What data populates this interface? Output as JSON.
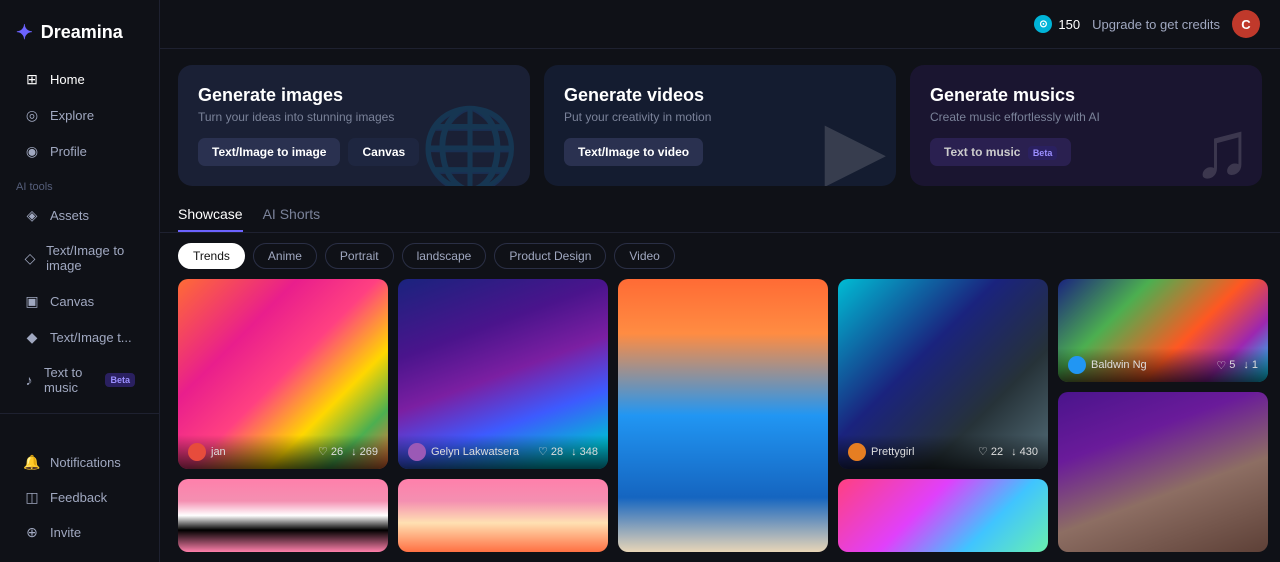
{
  "app": {
    "name": "Dreamina",
    "logo_icon": "✦"
  },
  "topbar": {
    "credits": "150",
    "upgrade_text": "Upgrade to get credits",
    "avatar_letter": "C"
  },
  "sidebar": {
    "nav_items": [
      {
        "id": "home",
        "label": "Home",
        "icon": "⊞"
      },
      {
        "id": "explore",
        "label": "Explore",
        "icon": "◎"
      },
      {
        "id": "profile",
        "label": "Profile",
        "icon": "◉"
      }
    ],
    "section_label": "AI tools",
    "tools": [
      {
        "id": "assets",
        "label": "Assets",
        "icon": "◈"
      },
      {
        "id": "text-image",
        "label": "Text/Image to image",
        "icon": "◇"
      },
      {
        "id": "canvas",
        "label": "Canvas",
        "icon": "▣"
      },
      {
        "id": "text-image-2",
        "label": "Text/Image t...",
        "icon": "◆"
      },
      {
        "id": "text-music",
        "label": "Text to music",
        "icon": "♪",
        "badge": "Beta"
      }
    ],
    "bottom_items": [
      {
        "id": "notifications",
        "label": "Notifications",
        "icon": "🔔"
      },
      {
        "id": "feedback",
        "label": "Feedback",
        "icon": "◫"
      },
      {
        "id": "invite",
        "label": "Invite",
        "icon": "⊕"
      }
    ]
  },
  "cards": [
    {
      "id": "images",
      "title": "Generate images",
      "subtitle": "Turn your ideas into stunning images",
      "buttons": [
        {
          "label": "Text/Image to image",
          "style": "primary"
        },
        {
          "label": "Canvas",
          "style": "secondary"
        }
      ]
    },
    {
      "id": "videos",
      "title": "Generate videos",
      "subtitle": "Put your creativity in motion",
      "buttons": [
        {
          "label": "Text/Image to video",
          "style": "primary"
        }
      ]
    },
    {
      "id": "musics",
      "title": "Generate musics",
      "subtitle": "Create music effortlessly with AI",
      "buttons": [
        {
          "label": "Text to music",
          "style": "music",
          "badge": "Beta"
        }
      ]
    }
  ],
  "tabs": [
    {
      "id": "showcase",
      "label": "Showcase",
      "active": true
    },
    {
      "id": "ai-shorts",
      "label": "AI Shorts",
      "active": false
    }
  ],
  "filters": [
    {
      "id": "trends",
      "label": "Trends",
      "active": true
    },
    {
      "id": "anime",
      "label": "Anime",
      "active": false
    },
    {
      "id": "portrait",
      "label": "Portrait",
      "active": false
    },
    {
      "id": "landscape",
      "label": "landscape",
      "active": false
    },
    {
      "id": "product-design",
      "label": "Product Design",
      "active": false
    },
    {
      "id": "video",
      "label": "Video",
      "active": false
    }
  ],
  "gallery": {
    "images": [
      {
        "id": "giraffe",
        "user": "jan",
        "likes": "26",
        "downloads": "269",
        "style": "img-giraffe",
        "height": "tall"
      },
      {
        "id": "girl-flowers",
        "user": "Gelyn Lakwatsera",
        "likes": "28",
        "downloads": "348",
        "style": "img-girl-flowers",
        "height": "tall"
      },
      {
        "id": "beach-girl",
        "user": "",
        "likes": "",
        "downloads": "",
        "style": "img-beach-girl",
        "height": "tall"
      },
      {
        "id": "cat-car",
        "user": "Prettygirl",
        "likes": "22",
        "downloads": "430",
        "style": "img-cat-car",
        "height": "medium"
      },
      {
        "id": "sneaker",
        "user": "Baldwin Ng",
        "likes": "5",
        "downloads": "1",
        "style": "img-sneaker",
        "height": "medium"
      },
      {
        "id": "girl-portrait",
        "user": "",
        "likes": "",
        "downloads": "",
        "style": "img-girl-portrait",
        "height": "medium"
      },
      {
        "id": "zebra",
        "user": "",
        "likes": "",
        "downloads": "",
        "style": "img-zebra",
        "height": "short"
      },
      {
        "id": "blob",
        "user": "",
        "likes": "",
        "downloads": "",
        "style": "img-blob",
        "height": "short"
      }
    ]
  }
}
